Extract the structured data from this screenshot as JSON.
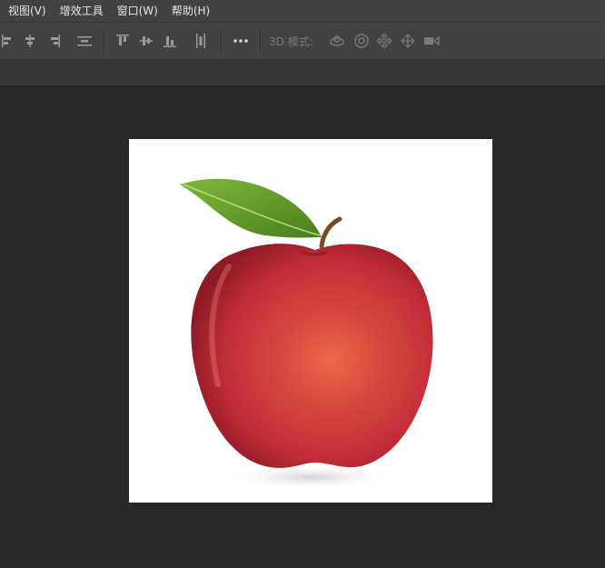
{
  "menubar": {
    "items": [
      "视图(V)",
      "增效工具",
      "窗口(W)",
      "帮助(H)"
    ]
  },
  "options_bar": {
    "mode3d_label": "3D 模式:",
    "icons": [
      "align-left-edges-icon",
      "align-horizontal-centers-icon",
      "align-right-edges-icon",
      "distribute-vertical-icon",
      "align-top-edges-icon",
      "align-vertical-centers-icon",
      "align-bottom-edges-icon",
      "distribute-horizontal-icon",
      "more-options-icon",
      "rotate-3d-icon",
      "roll-3d-icon",
      "pan-3d-icon",
      "slide-3d-icon",
      "scale-3d-icon"
    ]
  },
  "document": {
    "image": "red-apple-with-leaf"
  },
  "colors": {
    "menubar_bg": "#424242",
    "workspace_bg": "#282828",
    "apple_red": "#c8323a",
    "leaf_green": "#5c9a2a"
  }
}
